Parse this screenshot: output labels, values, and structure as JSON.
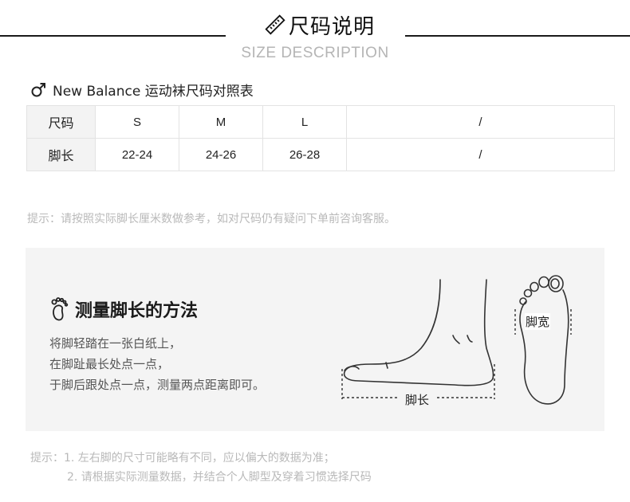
{
  "header": {
    "title": "尺码说明",
    "subtitle": "SIZE DESCRIPTION",
    "ruler_icon": "ruler-pencil-icon"
  },
  "size_table": {
    "title": "New Balance 运动袜尺码对照表",
    "gender_icon": "male-symbol-icon",
    "rows": [
      {
        "header": "尺码",
        "cells": [
          "S",
          "M",
          "L",
          "/"
        ]
      },
      {
        "header": "脚长",
        "cells": [
          "22-24",
          "24-26",
          "26-28",
          "/"
        ]
      }
    ]
  },
  "note_top": "提示：请按照实际脚长厘米数做参考，如对尺码仍有疑问下单前咨询客服。",
  "measure_panel": {
    "icon": "footprint-icon",
    "title": "测量脚长的方法",
    "steps": [
      "将脚轻踏在一张白纸上，",
      "在脚趾最长处点一点，",
      "于脚后跟处点一点，测量两点距离即可。"
    ],
    "foot_length_label": "脚长",
    "foot_width_label": "脚宽"
  },
  "note_bottom": {
    "prefix": "提示：",
    "line1": "1. 左右脚的尺寸可能略有不同，应以偏大的数据为准；",
    "line2": "2. 请根据实际测量数据，并结合个人脚型及穿着习惯选择尺码"
  },
  "colors": {
    "background": "#ffffff",
    "panel": "#f4f4f4",
    "rule_line": "#1a1a1a",
    "muted_text": "#b9b9b9",
    "table_border": "#e3e3e3"
  }
}
